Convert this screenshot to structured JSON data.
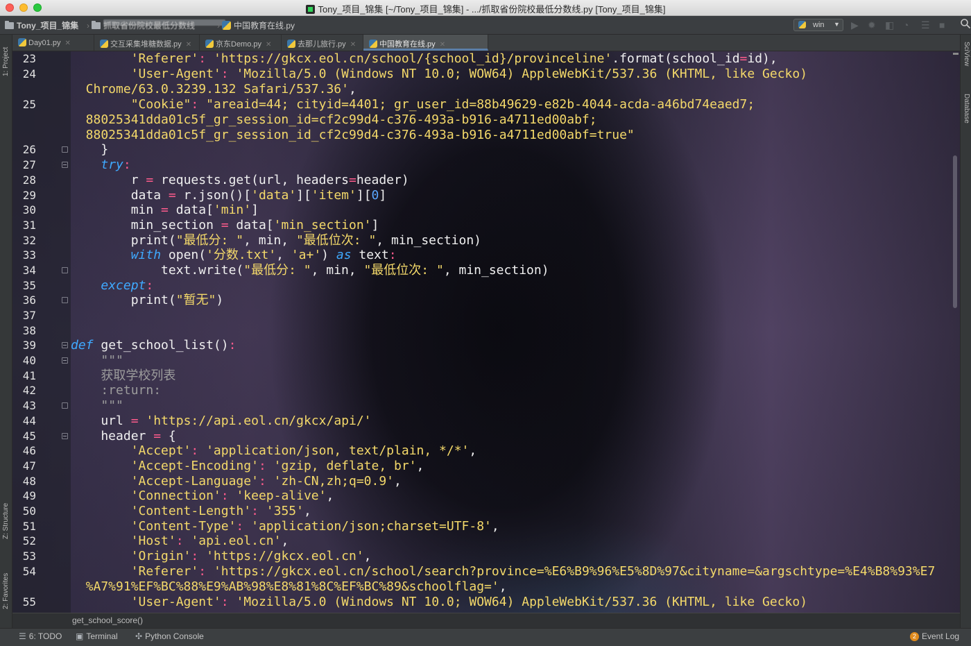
{
  "window": {
    "title": "Tony_项目_锦集 [~/Tony_项目_锦集] - .../抓取省份院校最低分数线.py [Tony_项目_锦集]"
  },
  "navbar": {
    "project": "Tony_项目_锦集",
    "folder": "抓取省份院校最低分数线",
    "file": "中国教育在线.py",
    "run_config": "win"
  },
  "left_strip": {
    "project_tab": "1: Project",
    "structure_tab": "Z: Structure",
    "favorites_tab": "2: Favorites"
  },
  "right_strip": {
    "sciview_tab": "SciView",
    "database_tab": "Database"
  },
  "tabs": [
    {
      "label": "Day01.py",
      "active": false
    },
    {
      "label": "交互采集堆糖数据.py",
      "active": false
    },
    {
      "label": "京东Demo.py",
      "active": false
    },
    {
      "label": "去那儿旅行.py",
      "active": false
    },
    {
      "label": "中国教育在线.py",
      "active": true
    }
  ],
  "editor": {
    "lines": [
      "23",
      "24",
      "",
      "25",
      "",
      "",
      "26",
      "27",
      "28",
      "29",
      "30",
      "31",
      "32",
      "33",
      "34",
      "35",
      "36",
      "37",
      "38",
      "39",
      "40",
      "41",
      "42",
      "43",
      "44",
      "45",
      "46",
      "47",
      "48",
      "49",
      "50",
      "51",
      "52",
      "53",
      "54",
      "",
      "55"
    ]
  },
  "breadcrumb": {
    "function": "get_school_score()"
  },
  "bottom_bar": {
    "todo": "6: TODO",
    "terminal": "Terminal",
    "python_console": "Python Console",
    "event_log": "Event Log",
    "event_count": "2"
  },
  "colors": {
    "string": "#f4d96a",
    "keyword": "#3fa9ff",
    "operator": "#ff5c8d",
    "docstring": "#9c9c9c",
    "active_tab_underline": "#5a7ea8"
  }
}
